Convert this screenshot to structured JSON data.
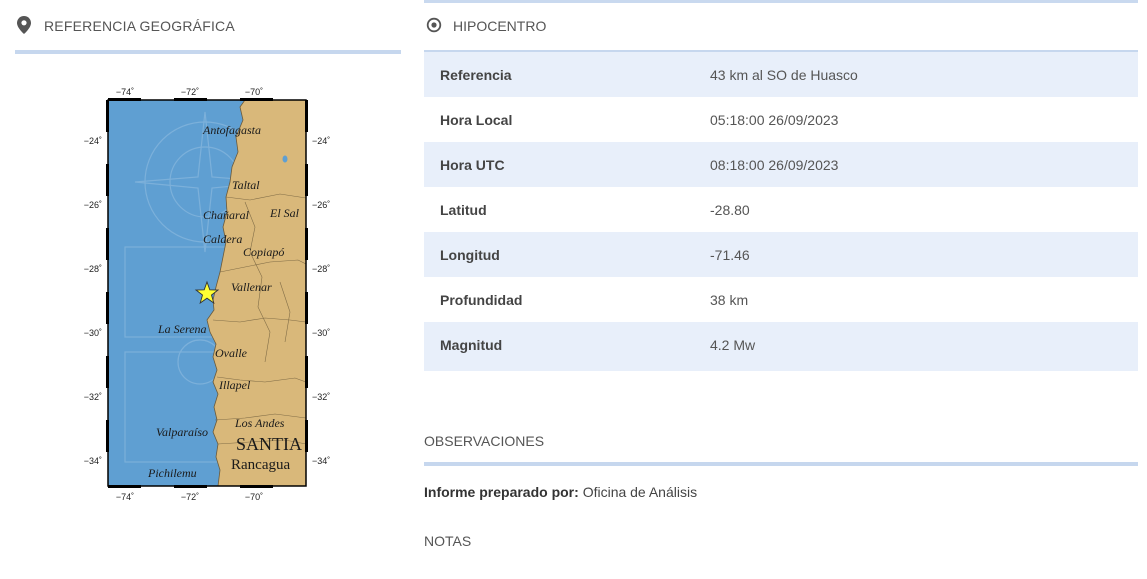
{
  "left_panel": {
    "title": "REFERENCIA GEOGRÁFICA",
    "icon": "map-pin-icon"
  },
  "map": {
    "lon_ticks": [
      "−74˚",
      "−72˚",
      "−70˚"
    ],
    "lat_ticks": [
      "−24˚",
      "−26˚",
      "−28˚",
      "−30˚",
      "−32˚",
      "−34˚"
    ],
    "cities": [
      "Antofagasta",
      "Taltal",
      "Chañaral",
      "El Sal",
      "Caldera",
      "Copiapó",
      "Vallenar",
      "La Serena",
      "Ovalle",
      "Illapel",
      "Los Andes",
      "Valparaíso",
      "SANTIA",
      "Rancagua",
      "Pichilemu"
    ],
    "epicenter_marker": "star-icon",
    "colors": {
      "ocean": "#5f9fd2",
      "land": "#d9b87a",
      "epicenter": "#ffff33"
    }
  },
  "right_panel": {
    "title": "HIPOCENTRO",
    "icon": "target-icon"
  },
  "hypocenter": [
    {
      "label": "Referencia",
      "value": "43 km al SO de Huasco"
    },
    {
      "label": "Hora Local",
      "value": "05:18:00 26/09/2023"
    },
    {
      "label": "Hora UTC",
      "value": "08:18:00 26/09/2023"
    },
    {
      "label": "Latitud",
      "value": "-28.80"
    },
    {
      "label": "Longitud",
      "value": "-71.46"
    },
    {
      "label": "Profundidad",
      "value": "38 km"
    },
    {
      "label": "Magnitud",
      "value": "4.2 Mw"
    }
  ],
  "observaciones": {
    "title": "OBSERVACIONES",
    "informe_label": "Informe preparado por:",
    "informe_value": "Oficina de Análisis"
  },
  "notas": {
    "title": "NOTAS"
  }
}
